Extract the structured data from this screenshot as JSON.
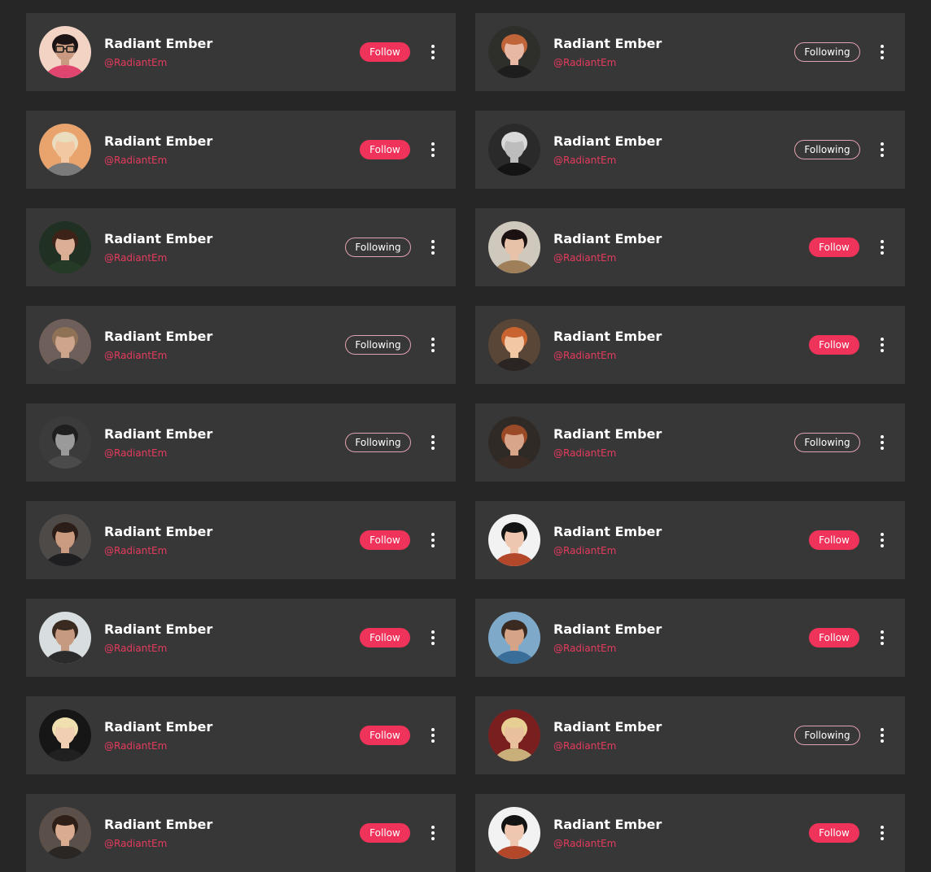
{
  "accent_color": "#f0335b",
  "handle_color": "#e53a5e",
  "card_background": "#373737",
  "page_background": "#262626",
  "cards": [
    {
      "name": "Radiant Ember",
      "handle": "@RadiantEm",
      "action": "Follow",
      "state": "follow",
      "avatar": {
        "bg": "#f3d3c4",
        "skin": "#c99a7f",
        "hair": "#1c1414",
        "shirt": "#e0456f",
        "glasses": true
      }
    },
    {
      "name": "Radiant Ember",
      "handle": "@RadiantEm",
      "action": "Following",
      "state": "following",
      "avatar": {
        "bg": "#2e2f2a",
        "skin": "#e7b9a4",
        "hair": "#c0643a",
        "shirt": "#1d1d1d"
      }
    },
    {
      "name": "Radiant Ember",
      "handle": "@RadiantEm",
      "action": "Follow",
      "state": "follow",
      "avatar": {
        "bg": "#e8a46c",
        "skin": "#f2c8a3",
        "hair": "#e9dcbf",
        "shirt": "#7a7a7a"
      }
    },
    {
      "name": "Radiant Ember",
      "handle": "@RadiantEm",
      "action": "Following",
      "state": "following",
      "avatar": {
        "bg": "#2a2a2a",
        "skin": "#bdbdbd",
        "hair": "#d9d9d9",
        "shirt": "#141414"
      }
    },
    {
      "name": "Radiant Ember",
      "handle": "@RadiantEm",
      "action": "Following",
      "state": "following",
      "avatar": {
        "bg": "#203022",
        "skin": "#dcae96",
        "hair": "#3d2218",
        "shirt": "#263a28"
      }
    },
    {
      "name": "Radiant Ember",
      "handle": "@RadiantEm",
      "action": "Follow",
      "state": "follow",
      "avatar": {
        "bg": "#cfc8bd",
        "skin": "#e7c2a8",
        "hair": "#1a1110",
        "shirt": "#9e7f5a"
      }
    },
    {
      "name": "Radiant Ember",
      "handle": "@RadiantEm",
      "action": "Following",
      "state": "following",
      "avatar": {
        "bg": "#6f5f5a",
        "skin": "#cda48c",
        "hair": "#8f7256",
        "shirt": "#3a3a3a"
      }
    },
    {
      "name": "Radiant Ember",
      "handle": "@RadiantEm",
      "action": "Follow",
      "state": "follow",
      "avatar": {
        "bg": "#5a4636",
        "skin": "#f1c7a4",
        "hair": "#c9632f",
        "shirt": "#2a2522"
      }
    },
    {
      "name": "Radiant Ember",
      "handle": "@RadiantEm",
      "action": "Following",
      "state": "following",
      "avatar": {
        "bg": "#3b3b3b",
        "skin": "#9a9a9a",
        "hair": "#1f1f1f",
        "shirt": "#4b4b4b"
      }
    },
    {
      "name": "Radiant Ember",
      "handle": "@RadiantEm",
      "action": "Following",
      "state": "following",
      "avatar": {
        "bg": "#2f2a26",
        "skin": "#d9a58a",
        "hair": "#9a4a26",
        "shirt": "#3a2c25"
      }
    },
    {
      "name": "Radiant Ember",
      "handle": "@RadiantEm",
      "action": "Follow",
      "state": "follow",
      "avatar": {
        "bg": "#4d4a48",
        "skin": "#cb9b80",
        "hair": "#2b1d17",
        "shirt": "#1f1f22"
      }
    },
    {
      "name": "Radiant Ember",
      "handle": "@RadiantEm",
      "action": "Follow",
      "state": "follow",
      "avatar": {
        "bg": "#f2f2f2",
        "skin": "#efc7b0",
        "hair": "#141414",
        "shirt": "#b3472a"
      }
    },
    {
      "name": "Radiant Ember",
      "handle": "@RadiantEm",
      "action": "Follow",
      "state": "follow",
      "avatar": {
        "bg": "#d8dde0",
        "skin": "#c69a80",
        "hair": "#3a2a20",
        "shirt": "#2b2b2b"
      }
    },
    {
      "name": "Radiant Ember",
      "handle": "@RadiantEm",
      "action": "Follow",
      "state": "follow",
      "avatar": {
        "bg": "#7ea9c9",
        "skin": "#d5a386",
        "hair": "#3b2a22",
        "shirt": "#3a6e9a"
      }
    },
    {
      "name": "Radiant Ember",
      "handle": "@RadiantEm",
      "action": "Follow",
      "state": "follow",
      "avatar": {
        "bg": "#161616",
        "skin": "#f0cfb2",
        "hair": "#f0e0b0",
        "shirt": "#202020"
      }
    },
    {
      "name": "Radiant Ember",
      "handle": "@RadiantEm",
      "action": "Following",
      "state": "following",
      "avatar": {
        "bg": "#7a1f1f",
        "skin": "#e8c09e",
        "hair": "#e7cf94",
        "shirt": "#c9b07a"
      }
    },
    {
      "name": "Radiant Ember",
      "handle": "@RadiantEm",
      "action": "Follow",
      "state": "follow",
      "avatar": {
        "bg": "#5b5049",
        "skin": "#d9ab90",
        "hair": "#2e1f18",
        "shirt": "#2a2624"
      }
    },
    {
      "name": "Radiant Ember",
      "handle": "@RadiantEm",
      "action": "Follow",
      "state": "follow",
      "avatar": {
        "bg": "#f2f2f2",
        "skin": "#efc7b0",
        "hair": "#141414",
        "shirt": "#b3472a"
      }
    }
  ]
}
